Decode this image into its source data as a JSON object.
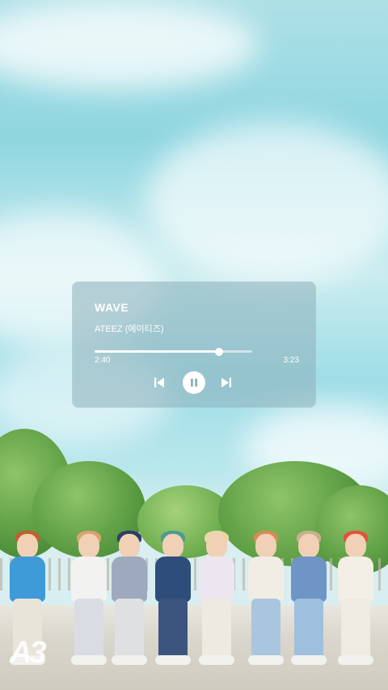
{
  "player": {
    "song_title": "WAVE",
    "artist": "ATEEZ (에이티즈)",
    "time_elapsed": "2:40",
    "time_total": "3:23",
    "progress": 0.79,
    "controls": {
      "previous_icon": "skip-previous-icon",
      "pause_icon": "pause-icon",
      "next_icon": "skip-next-icon"
    }
  },
  "watermark": "A3",
  "colors": {
    "sky": "#9fdde6",
    "card": "#8cafb9",
    "text": "#ffffff"
  }
}
